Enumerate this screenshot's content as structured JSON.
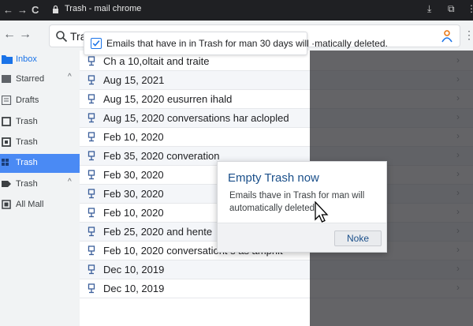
{
  "browser": {
    "back_glyph": "←",
    "forward_glyph": "→",
    "reload_glyph": "C",
    "tab_title": "Trash - mail chrome",
    "download_glyph": "⤓",
    "extension_glyph": "⧉",
    "menu_glyph": "⋮"
  },
  "toolbar": {
    "back_glyph": "←",
    "forward_glyph": "→",
    "search_value": "Trash",
    "more_glyph": "⋮"
  },
  "sidebar": {
    "items": [
      {
        "label": "Inbox",
        "icon": "folder-icon",
        "chev": ""
      },
      {
        "label": "Starred",
        "icon": "star-icon",
        "chev": "^"
      },
      {
        "label": "Drafts",
        "icon": "draft-icon",
        "chev": ""
      },
      {
        "label": "Trash",
        "icon": "trash-icon",
        "chev": ""
      },
      {
        "label": "Trash",
        "icon": "trash-icon",
        "chev": ""
      },
      {
        "label": "Trash",
        "icon": "trash-icon",
        "chev": ""
      },
      {
        "label": "Trash",
        "icon": "label-icon",
        "chev": "^"
      },
      {
        "label": "All Mall",
        "icon": "mail-stack-icon",
        "chev": ""
      }
    ]
  },
  "banner": {
    "text": "Emails that have in in Trash for man 30 days will ·matically deleted."
  },
  "mail_list": [
    "Ch a 10,oltait and traite",
    "Aug 15, 2021",
    "Aug 15, 2020 eusurren ihald",
    "Aug 15, 2020 conversations har aclopled",
    "Feb 10, 2020",
    "Feb 35, 2020 converation",
    "Feb 30, 2020",
    "Feb 30, 2020",
    "Feb 10, 2020",
    "Feb 25, 2020 and hente",
    "Feb 10, 2020 conversationt s as amphit",
    "Dec 10, 2019",
    "Dec 10, 2019"
  ],
  "row_chevron": "›",
  "dialog": {
    "title": "Empty Trash now",
    "body": "Emails thave in Trash for man will automatically deleted",
    "button": "Noke"
  },
  "colors": {
    "accent": "#1a73e8",
    "active_nav": "#4a8af4",
    "dialog_title": "#1a4f8a"
  }
}
